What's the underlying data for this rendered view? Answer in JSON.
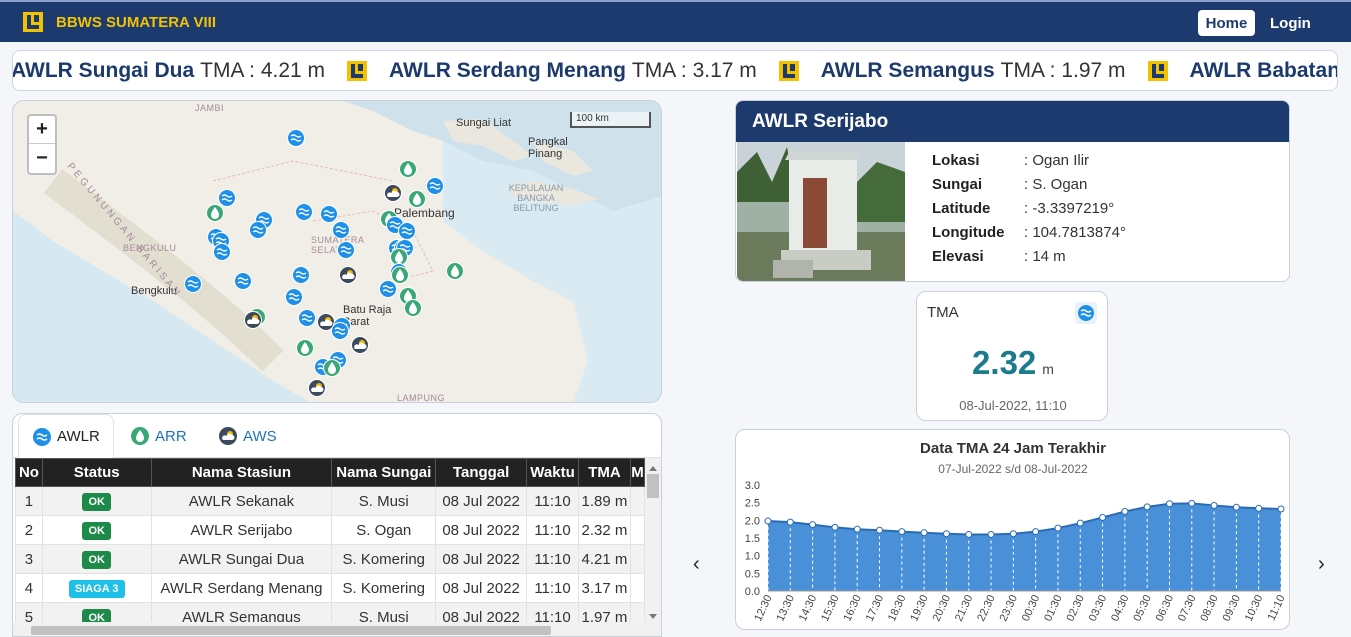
{
  "navbar": {
    "brand": "BBWS SUMATERA VIII",
    "home_label": "Home",
    "login_label": "Login",
    "logo_icon": "pupr-logo-icon"
  },
  "ticker": {
    "items": [
      {
        "name": "AWLR Sungai Dua",
        "value": "TMA : 4.21 m"
      },
      {
        "name": "AWLR Serdang Menang",
        "value": "TMA : 3.17 m"
      },
      {
        "name": "AWLR Semangus",
        "value": "TMA : 1.97 m"
      },
      {
        "name": "AWLR Babatan Sa",
        "value": ""
      }
    ]
  },
  "map": {
    "zoom_in": "+",
    "zoom_out": "−",
    "scale_label": "100 km",
    "labels": [
      {
        "text": "JAMBI",
        "type": "region"
      },
      {
        "text": "Sungai Liat",
        "type": "city"
      },
      {
        "text": "Pangkal Pinang",
        "type": "city"
      },
      {
        "text": "KEPULAUAN BANGKA BELITUNG",
        "type": "sea"
      },
      {
        "text": "Palembang",
        "type": "city"
      },
      {
        "text": "BENGKULU",
        "type": "region"
      },
      {
        "text": "Bengkulu",
        "type": "city"
      },
      {
        "text": "SUMATERA SELATAN",
        "type": "region"
      },
      {
        "text": "Batu Raja Barat",
        "type": "city"
      },
      {
        "text": "LAMPUNG",
        "type": "region"
      },
      {
        "text": "PEGUNUNGAN BARISAN",
        "type": "region"
      }
    ]
  },
  "tabs": [
    {
      "label": "AWLR",
      "icon": "water-level-icon",
      "active": true
    },
    {
      "label": "ARR",
      "icon": "rain-drop-icon",
      "active": false
    },
    {
      "label": "AWS",
      "icon": "weather-icon",
      "active": false
    }
  ],
  "table": {
    "headers": [
      "No",
      "Status",
      "Nama Stasiun",
      "Nama Sungai",
      "Tanggal",
      "Waktu",
      "TMA",
      "M"
    ],
    "rows": [
      {
        "no": "1",
        "status": "OK",
        "status_color": "#1e8a4a",
        "station": "AWLR Sekanak",
        "river": "S. Musi",
        "date": "08 Jul 2022",
        "time": "11:10",
        "tma": "1.89 m"
      },
      {
        "no": "2",
        "status": "OK",
        "status_color": "#1e8a4a",
        "station": "AWLR Serijabo",
        "river": "S. Ogan",
        "date": "08 Jul 2022",
        "time": "11:10",
        "tma": "2.32 m"
      },
      {
        "no": "3",
        "status": "OK",
        "status_color": "#1e8a4a",
        "station": "AWLR Sungai Dua",
        "river": "S. Komering",
        "date": "08 Jul 2022",
        "time": "11:10",
        "tma": "4.21 m"
      },
      {
        "no": "4",
        "status": "SIAGA 3",
        "status_color": "#1fc0e8",
        "station": "AWLR Serdang Menang",
        "river": "S. Komering",
        "date": "08 Jul 2022",
        "time": "11:10",
        "tma": "3.17 m"
      },
      {
        "no": "5",
        "status": "OK",
        "status_color": "#1e8a4a",
        "station": "AWLR Semangus",
        "river": "S. Musi",
        "date": "08 Jul 2022",
        "time": "11:10",
        "tma": "1.97 m"
      }
    ]
  },
  "station": {
    "title": "AWLR Serijabo",
    "fields": [
      {
        "key": "Lokasi",
        "value": ": Ogan Ilir"
      },
      {
        "key": "Sungai",
        "value": ": S. Ogan"
      },
      {
        "key": "Latitude",
        "value": ": -3.3397219°"
      },
      {
        "key": "Longitude",
        "value": ": 104.7813874°"
      },
      {
        "key": "Elevasi",
        "value": ": 14 m"
      }
    ]
  },
  "tma_card": {
    "label": "TMA",
    "value": "2.32",
    "unit": "m",
    "time": "08-Jul-2022, 11:10",
    "icon": "water-level-icon"
  },
  "carousel": {
    "prev": "‹",
    "next": "›"
  },
  "chart_data": {
    "type": "area",
    "title": "Data TMA 24 Jam Terakhir",
    "subtitle": "07-Jul-2022 s/d 08-Jul-2022",
    "ylim": [
      0,
      3.0
    ],
    "yticks": [
      "0.0",
      "0.5",
      "1.0",
      "1.5",
      "2.0",
      "2.5",
      "3.0"
    ],
    "x": [
      "12:30",
      "13:30",
      "14:30",
      "15:30",
      "16:30",
      "17:30",
      "18:30",
      "19:30",
      "20:30",
      "21:30",
      "22:30",
      "23:30",
      "00:30",
      "01:30",
      "02:30",
      "03:30",
      "04:30",
      "05:30",
      "06:30",
      "07:30",
      "08:30",
      "09:30",
      "10:30",
      "11:10"
    ],
    "series": [
      {
        "values": [
          1.98,
          1.95,
          1.88,
          1.8,
          1.75,
          1.72,
          1.68,
          1.65,
          1.62,
          1.6,
          1.6,
          1.62,
          1.68,
          1.78,
          1.92,
          2.08,
          2.25,
          2.38,
          2.47,
          2.48,
          2.42,
          2.37,
          2.34,
          2.32
        ]
      }
    ],
    "color": "#4a90d9"
  }
}
